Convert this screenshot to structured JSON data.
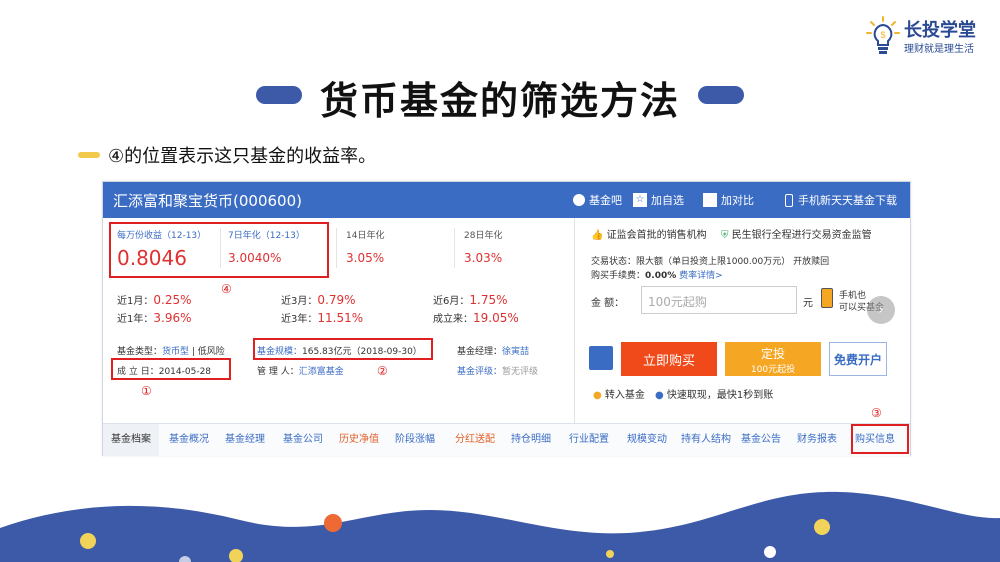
{
  "logo": {
    "name": "长投学堂",
    "slogan": "理财就是理生活"
  },
  "title": "货币基金的筛选方法",
  "subtitle": "④的位置表示这只基金的收益率。",
  "fund": {
    "name": "汇添富和聚宝货币(000600)",
    "header_actions": {
      "forum": "基金吧",
      "add": "加自选",
      "compare": "加对比",
      "mobile": "手机新天天基金下载"
    },
    "metrics": {
      "wanfen_label": "每万份收益（12-13）",
      "wanfen_value": "0.8046",
      "qiri_label": "7日年化（12-13）",
      "qiri_value": "3.0040%",
      "d14_label": "14日年化",
      "d14_value": "3.05%",
      "d28_label": "28日年化",
      "d28_value": "3.03%"
    },
    "returns": {
      "m1_label": "近1月：",
      "m1_value": "0.25%",
      "m3_label": "近3月：",
      "m3_value": "0.79%",
      "m6_label": "近6月：",
      "m6_value": "1.75%",
      "y1_label": "近1年：",
      "y1_value": "3.96%",
      "y3_label": "近3年：",
      "y3_value": "11.51%",
      "since_label": "成立来：",
      "since_value": "19.05%"
    },
    "info": {
      "type_label": "基金类型：",
      "type_value": "货币型",
      "risk": "| 低风险",
      "scale_label": "基金规模：",
      "scale_value": "165.83亿元（2018-09-30）",
      "manager_label": "基金经理：",
      "manager_value": "徐寅喆",
      "found_label": "成 立 日：",
      "found_value": "2014-05-28",
      "admin_label": "管 理 人：",
      "admin_value": "汇添富基金",
      "rating_label": "基金评级：",
      "rating_value": "暂无评级"
    },
    "annotations": {
      "c1": "①",
      "c2": "②",
      "c3": "③",
      "c4": "④"
    },
    "right": {
      "cert": "证监会首批的销售机构",
      "bank": "民生银行全程进行交易资金监管",
      "status": "交易状态：限大额（单日投资上限1000.00万元） 开放赎回",
      "fee_label": "购买手续费：",
      "fee_value": "0.00%",
      "fee_link": "费率详情>",
      "amount_label": "金      额：",
      "amount_placeholder": "100元起购",
      "unit": "元",
      "phone1": "手机也",
      "phone2": "可以买基金",
      "buy": "立即购买",
      "invest": "定投",
      "invest_sub": "100元起投",
      "open": "免费开户",
      "transfer": "转入基金",
      "redeem": "快速取现，最快1秒到账"
    },
    "tabs": [
      "基金档案",
      "基金概况",
      "基金经理",
      "基金公司",
      "历史净值",
      "阶段涨幅",
      "分红送配",
      "持仓明细",
      "行业配置",
      "规模变动",
      "持有人结构",
      "基金公告",
      "财务报表",
      "购买信息"
    ]
  },
  "colors": {
    "brand_blue": "#3b6cc4",
    "red": "#e03030",
    "orange": "#f5a623",
    "buy_red": "#f04a1a",
    "wave_blue": "#3d5aa8",
    "dot_yellow": "#f2d35a",
    "dot_orange": "#ee6a35"
  }
}
